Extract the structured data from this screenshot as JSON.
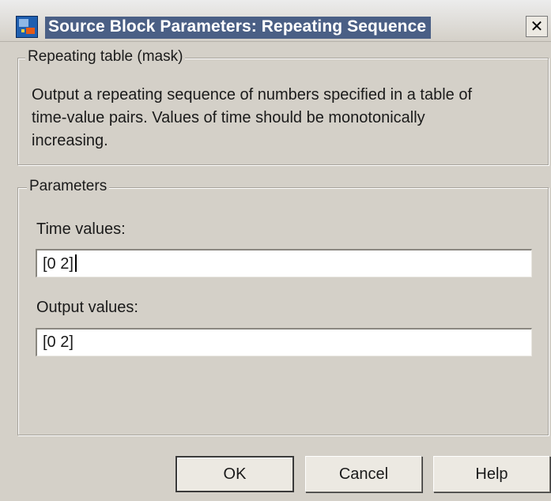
{
  "window": {
    "title": "Source Block Parameters: Repeating Sequence",
    "close_glyph": "✕",
    "icon": "simulink-block-icon"
  },
  "mask_group": {
    "legend": "Repeating table (mask)",
    "description_lines": [
      "Output a repeating sequence of numbers specified in a table of",
      "time-value pairs. Values of time should be monotonically",
      "increasing."
    ]
  },
  "parameters_group": {
    "legend": "Parameters",
    "time_label": "Time values:",
    "time_value": "[0 2]",
    "output_label": "Output values:",
    "output_value": "[0 2]"
  },
  "buttons": {
    "ok": "OK",
    "cancel": "Cancel",
    "help": "Help"
  },
  "colors": {
    "dialog_bg": "#d4d0c8",
    "title_bg": "#4a5f85",
    "title_text": "#ffffff"
  }
}
